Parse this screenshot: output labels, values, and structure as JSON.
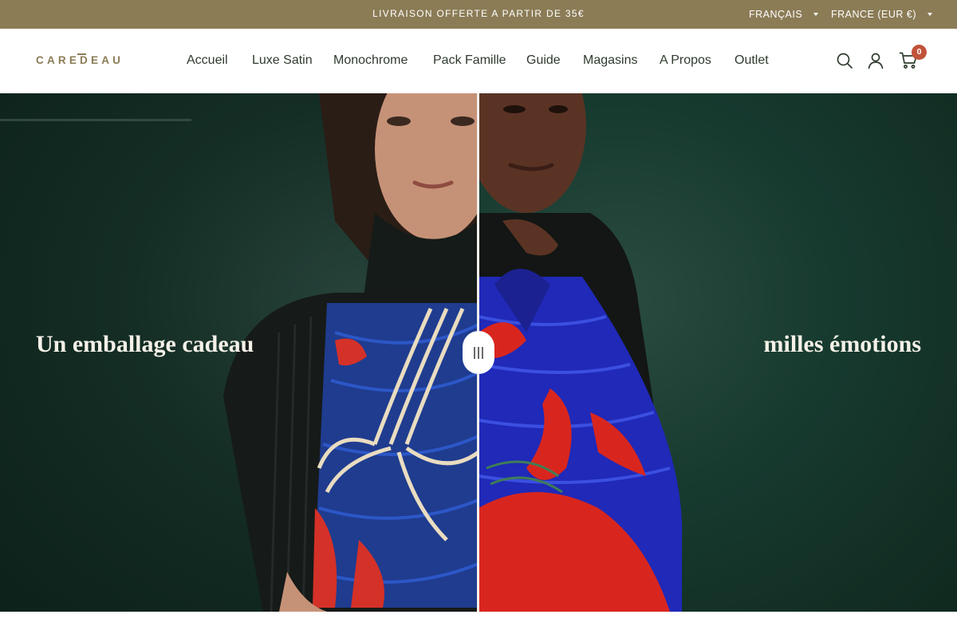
{
  "announcement": {
    "text": "LIVRAISON OFFERTE A PARTIR DE 35€",
    "language": "FRANÇAIS",
    "country": "FRANCE (EUR €)"
  },
  "header": {
    "logo": "CAREDEAU",
    "nav": [
      {
        "label": "Accueil"
      },
      {
        "label": "Luxe Satin"
      },
      {
        "label": "Monochrome"
      },
      {
        "label": "Pack Famille"
      },
      {
        "label": "Guide"
      },
      {
        "label": "Magasins"
      },
      {
        "label": "A Propos"
      },
      {
        "label": "Outlet"
      }
    ],
    "icons": {
      "search": "search-icon",
      "account": "user-icon",
      "cart": "cart-icon"
    },
    "cart_count": "0"
  },
  "hero": {
    "title_left": "Un emballage cadeau",
    "title_right": "milles émotions",
    "slider_handle_icon": "drag-handle-icon",
    "slider_position": 0.5
  },
  "colors": {
    "announcement_bg": "#8b7c56",
    "brand_gold": "#8b7c56",
    "hero_green": "#163329",
    "badge_red": "#c0533a",
    "wrap_blue": "#1f3fbf",
    "wrap_red": "#e0312c"
  }
}
